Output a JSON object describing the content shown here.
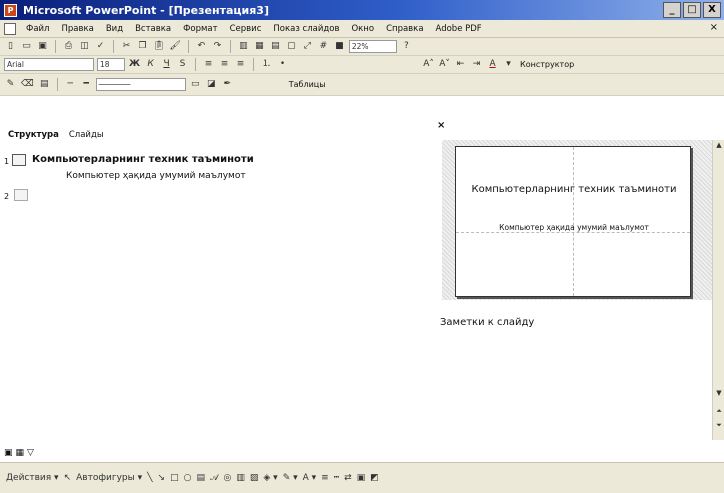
{
  "window": {
    "title": "Microsoft PowerPoint - [Презентация3]",
    "app_icon": "powerpoint-icon",
    "buttons": [
      "_",
      "□",
      "X"
    ]
  },
  "menu": {
    "items": [
      "Файл",
      "Правка",
      "Вид",
      "Вставка",
      "Формат",
      "Сервис",
      "Показ слайдов",
      "Окно",
      "Справка",
      "Adobe PDF"
    ],
    "close": "×"
  },
  "toolbar1": {
    "zoom": "22%"
  },
  "toolbar2": {
    "font": "Arial",
    "size": "18",
    "bold": "Ж",
    "italic": "К",
    "underline": "Ч",
    "shadow": "S",
    "font_color": "A",
    "grow": "A˄",
    "shrink": "A˅",
    "designer": "Конструктор"
  },
  "toolbar3": {
    "table": "Таблицы"
  },
  "tabs": {
    "outline": "Структура",
    "slides": "Слайды",
    "close": "×"
  },
  "outline": {
    "slide1_num": "1",
    "slide1_title": "Компьютерларнинг техник таъминоти",
    "slide1_sub": "Компьютер ҳақида умумий маълумот",
    "slide2_num": "2"
  },
  "slide": {
    "title": "Компьютерларнинг техник таъминоти",
    "subtitle": "Компьютер ҳақида умумий маълумот"
  },
  "notes": {
    "label": "Заметки к слайду"
  },
  "drawing": {
    "actions": "Действия ▾",
    "autoshapes": "Автофигуры ▾"
  }
}
